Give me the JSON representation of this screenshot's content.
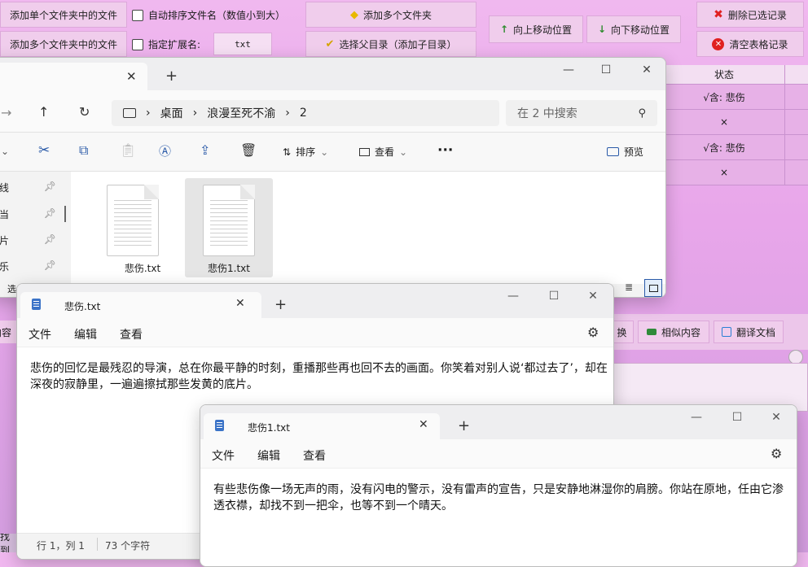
{
  "toolbar": {
    "add_single": "添加单个文件夹中的文件",
    "add_multi": "添加多个文件夹中的文件",
    "auto_sort": "自动排序文件名（数值小到大）",
    "ext_label": "指定扩展名:",
    "ext_value": "txt",
    "add_folders": "添加多个文件夹",
    "select_parent": "选择父目录（添加子目录）",
    "move_up": "向上移动位置",
    "move_down": "向下移动位置",
    "delete_selected": "删除已选记录",
    "clear_table": "清空表格记录"
  },
  "grid": {
    "header": "状态",
    "rows": [
      "√含: 悲伤",
      "×",
      "√含: 悲伤",
      "×"
    ]
  },
  "side_buttons": {
    "replace": "换",
    "similar": "相似内容",
    "translate": "翻译文档"
  },
  "explorer": {
    "breadcrumb": [
      "桌面",
      "浪漫至死不渝",
      "2"
    ],
    "search_placeholder": "在 2 中搜索",
    "sort": "排序",
    "view": "查看",
    "preview": "预览",
    "left_items": [
      "线",
      "当",
      "片",
      "乐"
    ],
    "status_fragment": "选",
    "files": [
      "悲伤.txt",
      "悲伤1.txt"
    ]
  },
  "notepad1": {
    "tab_title": "悲伤.txt",
    "menu": [
      "文件",
      "编辑",
      "查看"
    ],
    "content": "悲伤的回忆是最残忍的导演，总在你最平静的时刻，重播那些再也回不去的画面。你笑着对别人说‘都过去了’，却在深夜的寂静里，一遍遍擦拭那些发黄的底片。",
    "status_pos": "行 1，列 1",
    "status_chars": "73 个字符"
  },
  "notepad2": {
    "tab_title": "悲伤1.txt",
    "menu": [
      "文件",
      "编辑",
      "查看"
    ],
    "content": "有些悲伤像一场无声的雨，没有闪电的警示，没有雷声的宣告，只是安静地淋湿你的肩膀。你站在原地，任由它渗透衣襟，却找不到一把伞，也等不到一个晴天。"
  },
  "bg_fragments": {
    "left_mid": "内容",
    "left_bottom": "找到"
  }
}
